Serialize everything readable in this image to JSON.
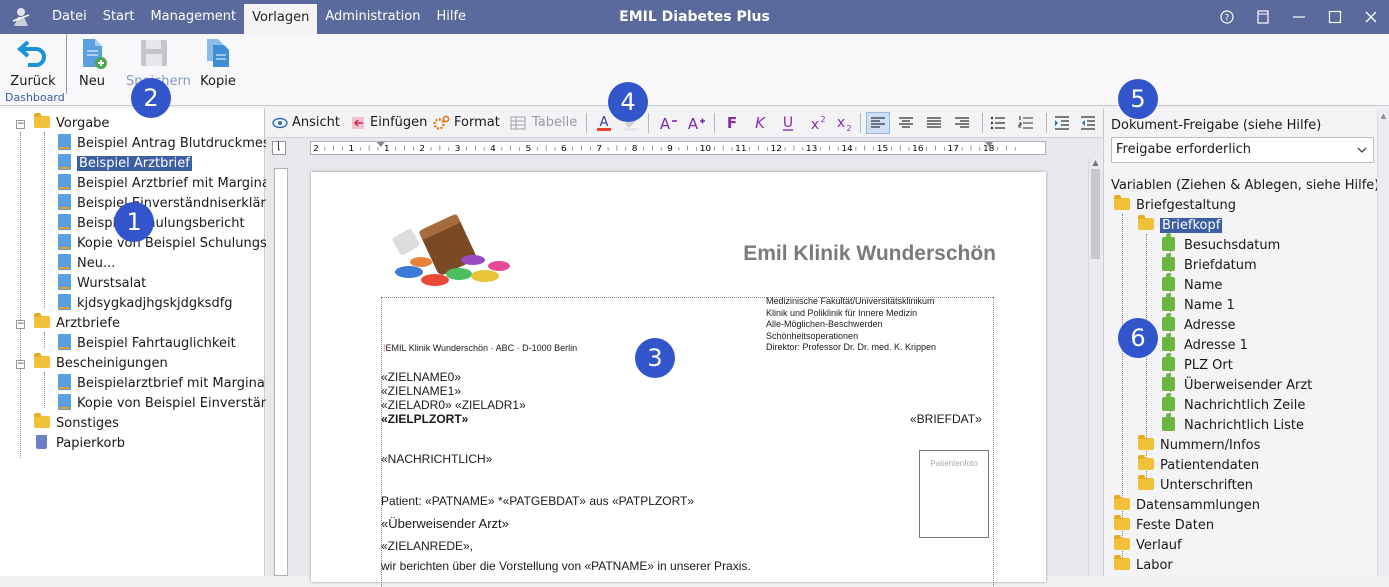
{
  "titlebar": {
    "menu": [
      "Datei",
      "Start",
      "Management",
      "Vorlagen",
      "Administration",
      "Hilfe"
    ],
    "active_menu": "Vorlagen",
    "title": "EMIL Diabetes Plus"
  },
  "ribbon": {
    "back": "Zurück",
    "new": "Neu",
    "save": "Speichern",
    "copy": "Kopie",
    "group_label": "Dashboard"
  },
  "tree": {
    "vorgabe": "Vorgabe",
    "vorgabe_items": [
      "Beispiel Antrag Blutdruckmessg",
      "Beispiel Arztbrief",
      "Beispiel Arztbrief mit Marginali",
      "Beispiel Einverständniserklärung",
      "Beispiel Schulungsbericht",
      "Kopie von Beispiel Schulungsbe",
      "Neu...",
      "Wurstsalat",
      "kjdsygkadjhgskjdgksdfg"
    ],
    "arztbriefe": "Arztbriefe",
    "arztbriefe_items": [
      "Beispiel Fahrtauglichkeit"
    ],
    "bescheinigungen": "Bescheinigungen",
    "bescheinigungen_items": [
      "Beispielarztbrief mit Marginalie",
      "Kopie von Beispiel Einverständn"
    ],
    "sonstiges": "Sonstiges",
    "papierkorb": "Papierkorb"
  },
  "editor_toolbar": {
    "view": "Ansicht",
    "insert": "Einfügen",
    "format": "Format",
    "table": "Tabelle",
    "ruler_numbers": [
      "2",
      "1",
      "1",
      "2",
      "3",
      "4",
      "5",
      "6",
      "7",
      "8",
      "9",
      "10",
      "11",
      "12",
      "13",
      "14",
      "15",
      "16",
      "17",
      "18"
    ]
  },
  "document": {
    "clinic": "Emil Klinik Wunderschön",
    "header_right": [
      "Medizinische Fakultät/Universitätsklinikum",
      "Klinik und Poliklinik für Innere Medizin",
      "Alle-Möglichen-Beschwerden",
      "Schönheitsoperationen",
      "Direktor: Professor Dr. Dr. med. K. Krippen"
    ],
    "return_address": "EMIL Klinik Wunderschön · ABC · D-1000 Berlin",
    "lines": {
      "name0": "«ZIELNAME0»",
      "name1": "«ZIELNAME1»",
      "adr0": "«ZIELADR0»",
      "adr1": "«ZIELADR1»",
      "plzort": "«ZIELPLZORT»",
      "date": "«BRIEFDAT»",
      "cc": "«NACHRICHTLICH»",
      "patient_prefix": "Patient: ",
      "patname": "«PATNAME»",
      "star": " *",
      "patgebdat": "«PATGEBDAT»",
      "aus": " aus ",
      "patplzort": "«PATPLZORT»",
      "referrer": "«Überweisender Arzt»",
      "salutation": "«ZIELANREDE»,",
      "body_a": "wir berichten über die Vorstellung von ",
      "body_b": "«PATNAME»",
      "body_c": " in unserer Praxis."
    },
    "patient_label": "Patientenfoto"
  },
  "right_panel": {
    "release_label": "Dokument-Freigabe (siehe Hilfe)",
    "release_value": "Freigabe erforderlich",
    "vars_label": "Variablen (Ziehen & Ablegen, siehe Hilfe)",
    "briefgestaltung": "Briefgestaltung",
    "briefkopf": "Briefkopf",
    "briefkopf_items": [
      "Besuchsdatum",
      "Briefdatum",
      "Name",
      "Name 1",
      "Adresse",
      "Adresse 1",
      "PLZ Ort",
      "Überweisender Arzt",
      "Nachrichtlich Zeile",
      "Nachrichtlich Liste"
    ],
    "bg_subfolders": [
      "Nummern/Infos",
      "Patientendaten",
      "Unterschriften"
    ],
    "top_folders": [
      "Datensammlungen",
      "Feste Daten",
      "Verlauf",
      "Labor"
    ]
  },
  "badges": [
    "1",
    "2",
    "3",
    "4",
    "5",
    "6"
  ],
  "colors": {
    "titlebar": "#5a6a9c",
    "selection": "#3c5ea3",
    "badge": "#3355cc",
    "placeholder_marker": "#c03030"
  }
}
